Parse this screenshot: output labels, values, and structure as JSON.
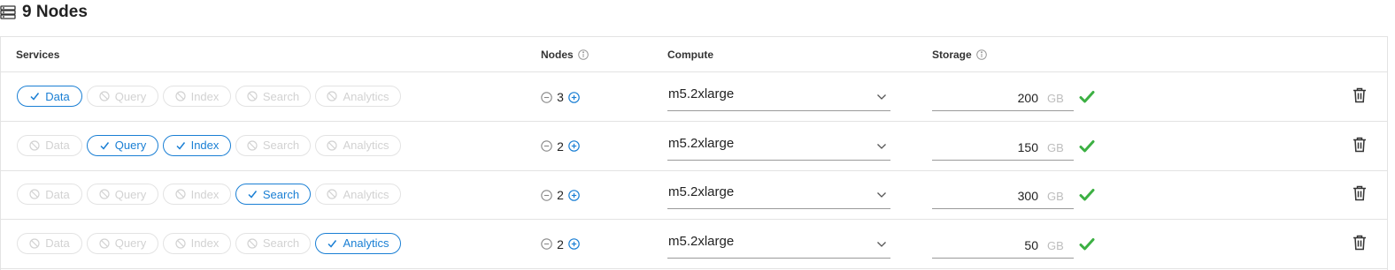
{
  "header": {
    "title": "9 Nodes",
    "icon": "server-stack-icon"
  },
  "table": {
    "columns": {
      "services": "Services",
      "nodes": "Nodes",
      "compute": "Compute",
      "storage": "Storage"
    },
    "service_names": [
      "Data",
      "Query",
      "Index",
      "Search",
      "Analytics"
    ],
    "rows": [
      {
        "services": [
          true,
          false,
          false,
          false,
          false
        ],
        "nodes": "3",
        "compute": "m5.2xlarge",
        "storage": "200",
        "unit": "GB"
      },
      {
        "services": [
          false,
          true,
          true,
          false,
          false
        ],
        "nodes": "2",
        "compute": "m5.2xlarge",
        "storage": "150",
        "unit": "GB"
      },
      {
        "services": [
          false,
          false,
          false,
          true,
          false
        ],
        "nodes": "2",
        "compute": "m5.2xlarge",
        "storage": "300",
        "unit": "GB"
      },
      {
        "services": [
          false,
          false,
          false,
          false,
          true
        ],
        "nodes": "2",
        "compute": "m5.2xlarge",
        "storage": "50",
        "unit": "GB"
      }
    ]
  },
  "colors": {
    "accent": "#1a7fd4",
    "success": "#3cb043",
    "disabled": "#d2d2d2"
  }
}
